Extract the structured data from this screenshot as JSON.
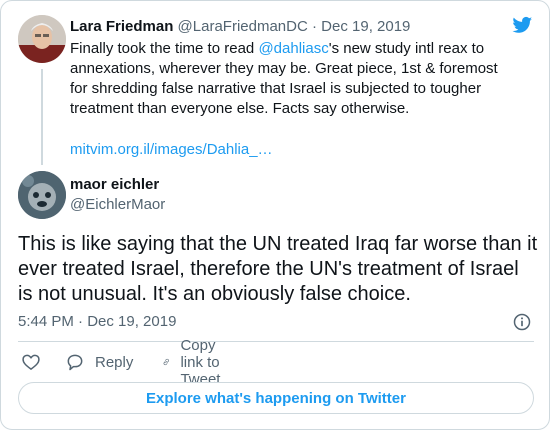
{
  "colors": {
    "accent": "#1d9bf0",
    "text": "#0f1419",
    "secondary_text": "#536471",
    "border": "#cfd9de"
  },
  "icons": {
    "logo": "twitter-bird-icon",
    "info": "info-icon",
    "like": "heart-icon",
    "reply": "speech-bubble-icon",
    "copy_link": "link-icon"
  },
  "parent_tweet": {
    "author_name": "Lara Friedman",
    "handle": "@LaraFriedmanDC",
    "separator": "·",
    "date": "Dec 19, 2019",
    "text_before_mention": "Finally took the time to read ",
    "mention": "@dahliasc",
    "text_after_mention": "'s new study intl reax to annexations, wherever they may be. Great piece, 1st & foremost for shredding false narrative that Israel is subjected to tougher treatment than everyone else. Facts say otherwise.",
    "link": "mitvim.org.il/images/Dahlia_…"
  },
  "main_tweet": {
    "author_name": "maor eichler",
    "handle": "@EichlerMaor",
    "text": "This is like saying that the UN treated Iraq far worse than it ever treated Israel, therefore the UN's treatment of Israel is not unusual. It's an obviously false choice.",
    "timestamp": "5:44 PM · Dec 19, 2019"
  },
  "actions": {
    "reply_label": "Reply",
    "copy_link_label": "Copy link to Tweet"
  },
  "explore": {
    "label": "Explore what's happening on Twitter"
  }
}
